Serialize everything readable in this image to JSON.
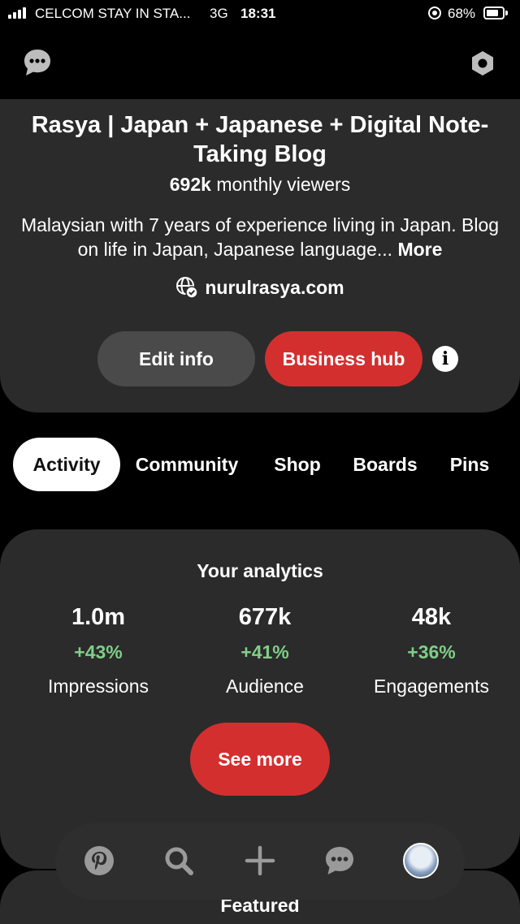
{
  "status_bar": {
    "carrier": "CELCOM STAY IN STA...",
    "network": "3G",
    "time": "18:31",
    "battery": "68%",
    "battery_level": 0.68
  },
  "top_bar": {
    "left_icon": "chat-bubble-icon",
    "right_icon": "hexagon-settings-icon"
  },
  "profile": {
    "name": "Rasya | Japan + Japanese + Digital Note-Taking Blog",
    "viewers_count": "692k",
    "viewers_label": "monthly viewers",
    "bio": "Malaysian with 7 years of experience living in Japan. Blog on life in Japan, Japanese language...",
    "bio_more": "More",
    "website": "nurulrasya.com",
    "edit_button": "Edit info",
    "business_button": "Business hub"
  },
  "tabs": [
    {
      "label": "Activity",
      "active": true
    },
    {
      "label": "Community",
      "active": false
    },
    {
      "label": "Shop",
      "active": false
    },
    {
      "label": "Boards",
      "active": false
    },
    {
      "label": "Pins",
      "active": false
    }
  ],
  "analytics": {
    "title": "Your analytics",
    "metrics": [
      {
        "value": "1.0m",
        "change": "+43%",
        "label": "Impressions"
      },
      {
        "value": "677k",
        "change": "+41%",
        "label": "Audience"
      },
      {
        "value": "48k",
        "change": "+36%",
        "label": "Engagements"
      }
    ],
    "see_more": "See more"
  },
  "featured": {
    "title": "Featured"
  },
  "colors": {
    "accent_red": "#d42f2f",
    "positive_green": "#7fcf88",
    "card_bg": "#2b2b2b"
  },
  "bottom_nav": [
    "pinterest-icon",
    "search-icon",
    "add-icon",
    "chat-icon",
    "profile-avatar"
  ]
}
